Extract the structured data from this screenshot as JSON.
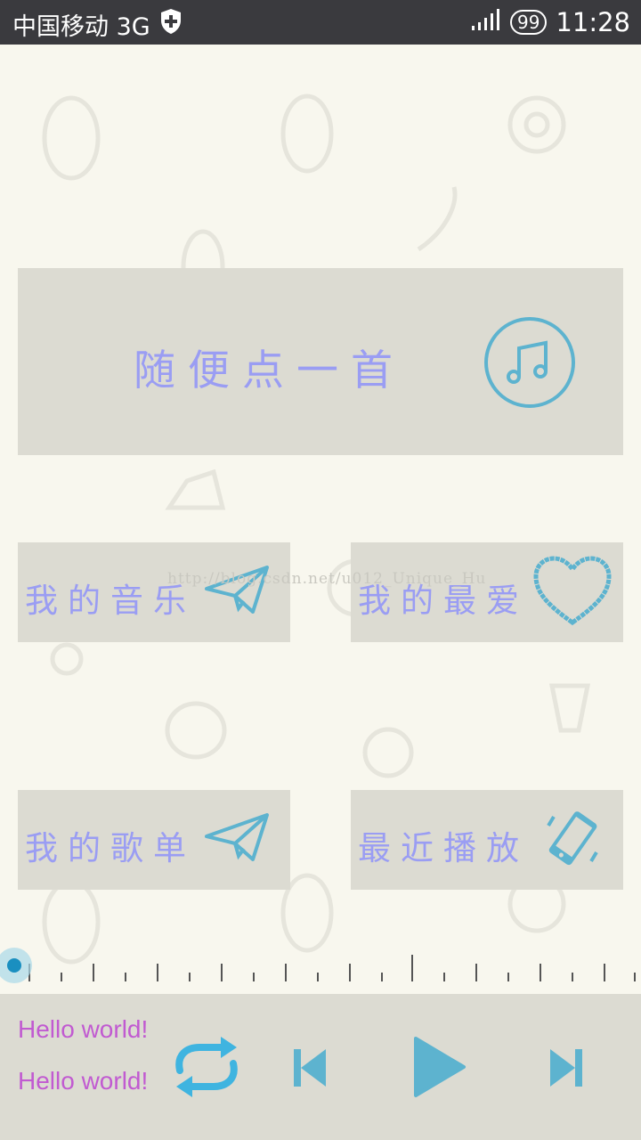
{
  "status_bar": {
    "carrier": "中国移动 3G",
    "battery": "99",
    "time": "11:28"
  },
  "cards": {
    "random_play": "随便点一首",
    "my_music": "我的音乐",
    "my_favorite": "我的最爱",
    "my_playlist": "我的歌单",
    "recent_play": "最近播放"
  },
  "watermark": "http://blog.csdn.net/u012_Unique_Hu",
  "seek_bar": {
    "progress": 0
  },
  "player": {
    "line1": "Hello world!",
    "line2": "Hello world!"
  },
  "colors": {
    "accent_icon": "#5db3cf",
    "card_text": "#9a9df3",
    "player_text": "#c15ad1",
    "card_bg": "#dcdbd2",
    "page_bg": "#f8f7ee"
  },
  "icons": [
    "shield-plus-icon",
    "signal-icon",
    "music-note-icon",
    "paper-plane-icon",
    "heart-icon",
    "phone-rotate-icon",
    "repeat-icon",
    "previous-icon",
    "play-icon",
    "next-icon"
  ]
}
